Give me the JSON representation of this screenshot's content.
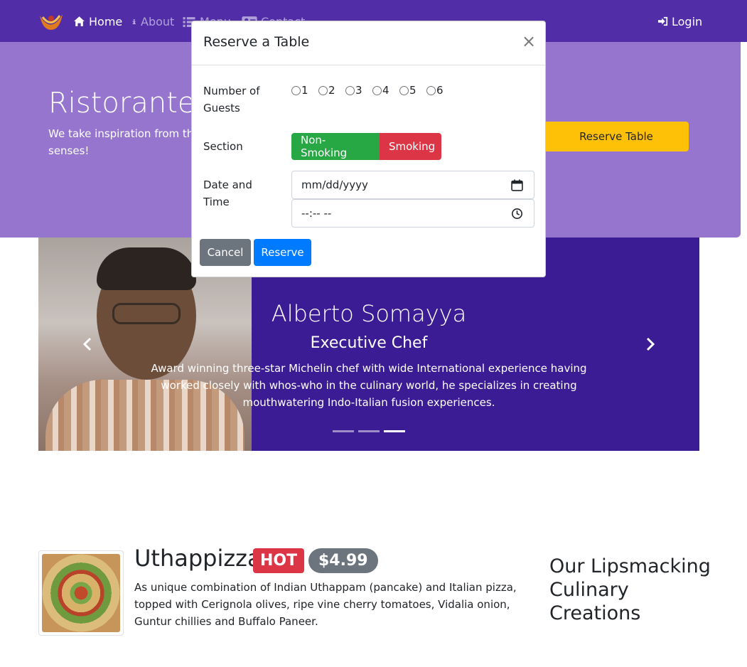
{
  "navbar": {
    "brand_logo": "restaurant-logo",
    "items": [
      {
        "label": "Home",
        "icon": "home-icon"
      },
      {
        "label": "About",
        "icon": "info-icon"
      },
      {
        "label": "Menu",
        "icon": "list-icon"
      },
      {
        "label": "Contact",
        "icon": "address-card-icon"
      }
    ],
    "login": {
      "label": "Login",
      "icon": "sign-in-icon"
    }
  },
  "jumbotron": {
    "title": "Ristorante c",
    "text": "We take inspiration from the a unique fusion experience. C tickle your culinary senses!",
    "reserve_button": "Reserve Table"
  },
  "carousel": {
    "name": "Alberto Somayya",
    "role": "Executive Chef",
    "description": "Award winning three-star Michelin chef with wide International experience having worked closely with whos-who in the culinary world, he specializes in creating mouthwatering Indo-Italian fusion experiences.",
    "prev_label": "Previous",
    "next_label": "Next",
    "indicator_count": 3,
    "active_indicator": 3
  },
  "dish": {
    "name": "Uthappizza",
    "label": "HOT",
    "price": "$4.99",
    "description": "As unique combination of Indian Uthappam (pancake) and Italian pizza, topped with Cerignola olives, ripe vine cherry tomatoes, Vidalia onion, Guntur chillies and Buffalo Paneer."
  },
  "side": {
    "title": "Our Lipsmacking Culinary Creations"
  },
  "modal": {
    "title": "Reserve a Table",
    "close": "×",
    "guests_label": "Number of Guests",
    "guest_options": [
      "1",
      "2",
      "3",
      "4",
      "5",
      "6"
    ],
    "section_label": "Section",
    "section_options": [
      "Non-Smoking",
      "Smoking"
    ],
    "datetime_label": "Date and Time",
    "date_placeholder": "mm/dd/yyyy",
    "time_placeholder": "--:-- --",
    "cancel_button": "Cancel",
    "reserve_button": "Reserve"
  },
  "colors": {
    "navbar": "#512DA8",
    "jumbotron": "#9575CD",
    "carousel": "#3b1c94",
    "reserve_table": "#FFC107",
    "non_smoking": "#28a745",
    "smoking": "#dc3545",
    "primary": "#007bff",
    "secondary": "#6c757d"
  }
}
